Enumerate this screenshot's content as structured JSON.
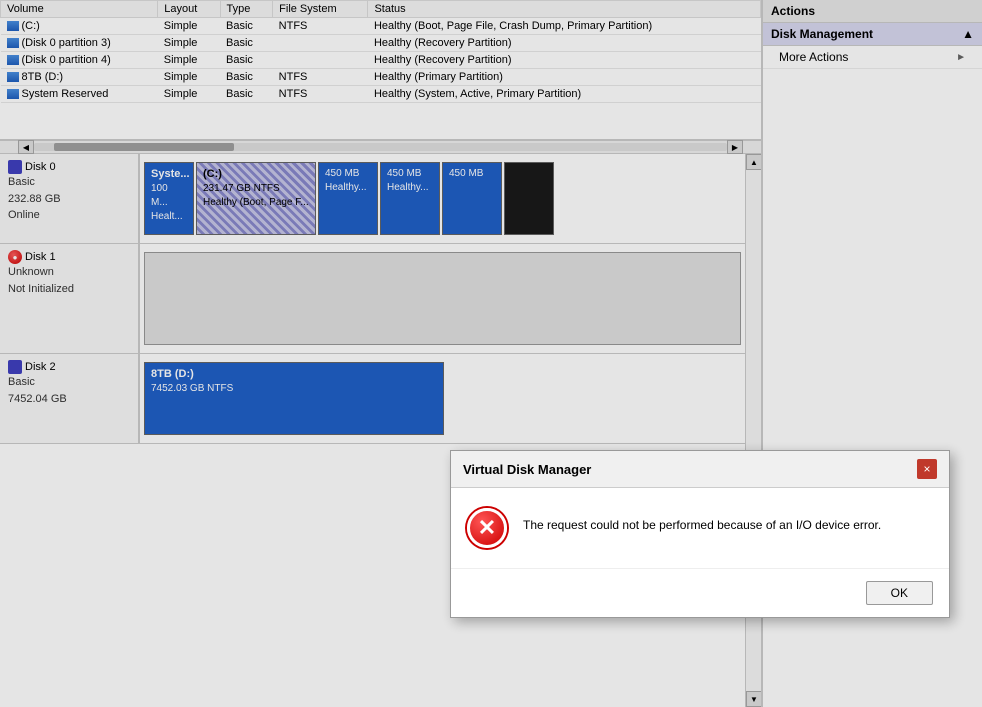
{
  "actions": {
    "panel_title": "Actions",
    "disk_management_label": "Disk Management",
    "more_actions_label": "More Actions"
  },
  "table": {
    "columns": [
      "Volume",
      "Layout",
      "Type",
      "File System",
      "Status"
    ],
    "rows": [
      {
        "volume": "(C:)",
        "layout": "Simple",
        "type": "Basic",
        "fs": "NTFS",
        "status": "Healthy (Boot, Page File, Crash Dump, Primary Partition)"
      },
      {
        "volume": "(Disk 0 partition 3)",
        "layout": "Simple",
        "type": "Basic",
        "fs": "",
        "status": "Healthy (Recovery Partition)"
      },
      {
        "volume": "(Disk 0 partition 4)",
        "layout": "Simple",
        "type": "Basic",
        "fs": "",
        "status": "Healthy (Recovery Partition)"
      },
      {
        "volume": "8TB (D:)",
        "layout": "Simple",
        "type": "Basic",
        "fs": "NTFS",
        "status": "Healthy (Primary Partition)"
      },
      {
        "volume": "System Reserved",
        "layout": "Simple",
        "type": "Basic",
        "fs": "NTFS",
        "status": "Healthy (System, Active, Primary Partition)"
      }
    ]
  },
  "disk0": {
    "name": "Disk 0",
    "type": "Basic",
    "size": "232.88 GB",
    "status": "Online",
    "partitions": [
      {
        "name": "Syste...",
        "size": "100 M...",
        "fs": "",
        "status": "Healt..."
      },
      {
        "name": "(C:)",
        "size": "231.47 GB NTFS",
        "fs": "",
        "status": "Healthy (Boot, Page F..."
      },
      {
        "name": "",
        "size": "450 MB",
        "fs": "",
        "status": "Healthy..."
      },
      {
        "name": "",
        "size": "450 MB",
        "fs": "",
        "status": "Healthy..."
      },
      {
        "name": "",
        "size": "450 MB",
        "fs": "",
        "status": ""
      },
      {
        "name": "",
        "size": "",
        "fs": "",
        "status": ""
      }
    ]
  },
  "disk1": {
    "name": "Disk 1",
    "type": "Unknown",
    "size": "",
    "status": "Not Initialized"
  },
  "disk2": {
    "name": "Disk 2",
    "type": "Basic",
    "size": "7452.04 GB",
    "status": "",
    "partition_name": "8TB  (D:)",
    "partition_size": "7452.03 GB NTFS"
  },
  "modal": {
    "title": "Virtual Disk Manager",
    "message": "The request could not be performed because of an I/O device error.",
    "ok_label": "OK",
    "close_label": "×"
  }
}
